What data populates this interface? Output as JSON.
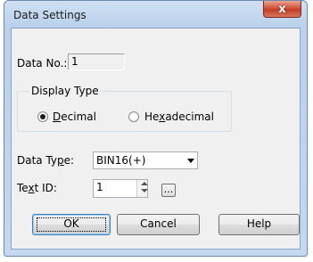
{
  "window": {
    "title": "Data Settings",
    "close_glyph": "x"
  },
  "data_no": {
    "label_pre": "Data No",
    "label_post": ".:",
    "value": "1"
  },
  "display_type": {
    "legend": "Display Type",
    "decimal": {
      "pre": "",
      "u": "D",
      "post": "ecimal",
      "selected": true
    },
    "hexadecimal": {
      "pre": "He",
      "u": "x",
      "post": "adecimal",
      "selected": false
    }
  },
  "data_type": {
    "label_pre": "Data Ty",
    "label_u": "p",
    "label_post": "e:",
    "selected": "BIN16(+)"
  },
  "text_id": {
    "label_pre": "Te",
    "label_u": "x",
    "label_post": "t ID:",
    "value": "1",
    "browse_label": "..."
  },
  "buttons": {
    "ok": "OK",
    "cancel": "Cancel",
    "help": "Help"
  },
  "icons": {
    "close": "close-icon",
    "radio": "radio-icon",
    "dropdown": "chevron-down-icon",
    "spin": "spin-arrows-icon"
  }
}
